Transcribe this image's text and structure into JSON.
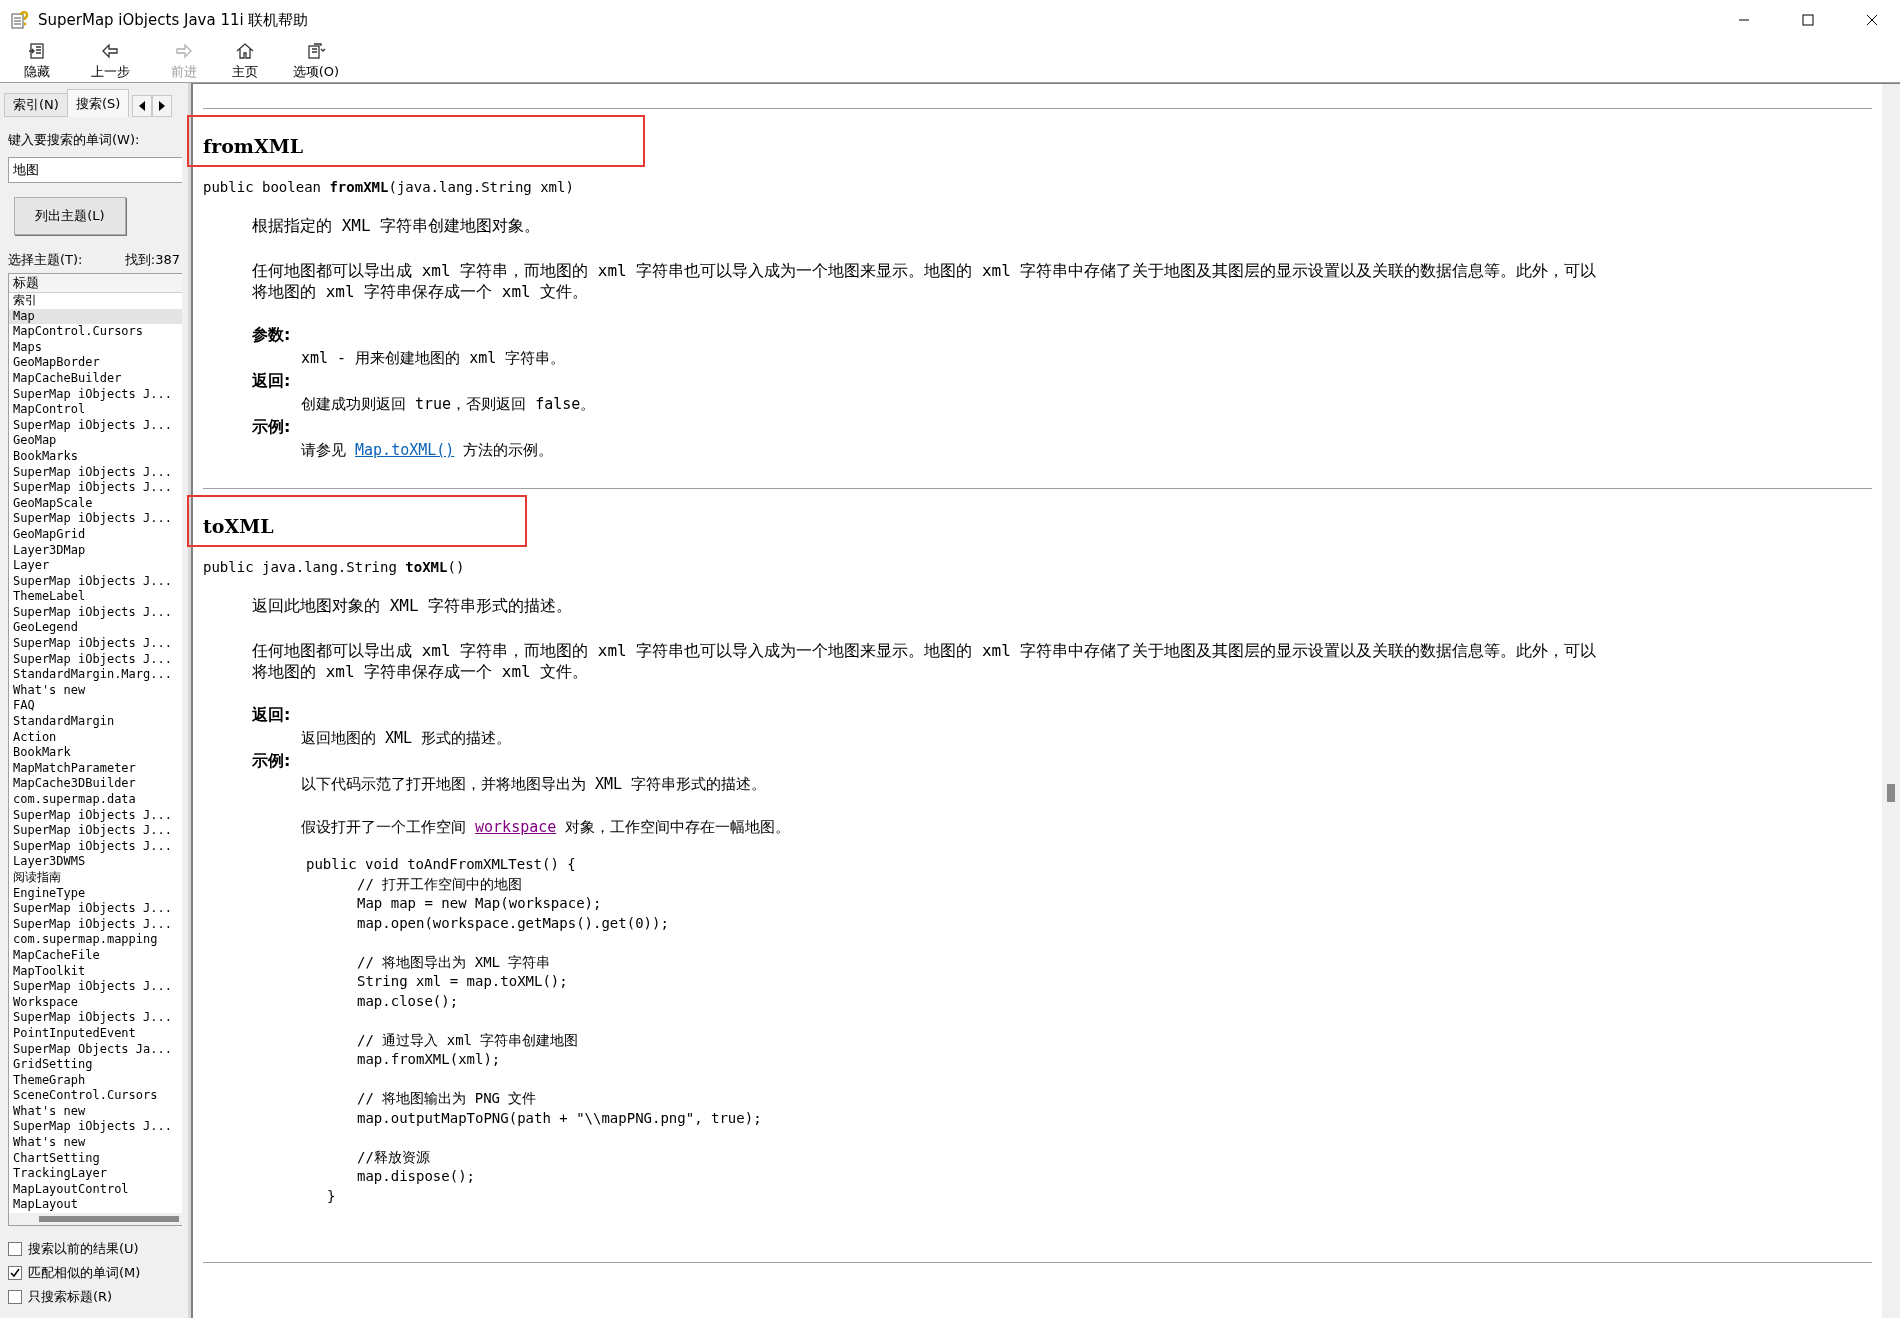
{
  "window": {
    "title": "SuperMap iObjects Java 11i 联机帮助"
  },
  "toolbar": [
    {
      "label": "隐藏",
      "disabled": false
    },
    {
      "label": "上一步",
      "disabled": false
    },
    {
      "label": "前进",
      "disabled": true
    },
    {
      "label": "主页",
      "disabled": false
    },
    {
      "label": "选项(O)",
      "disabled": false
    }
  ],
  "sidebar": {
    "tabs": [
      {
        "label": "索引(N)",
        "selected": false
      },
      {
        "label": "搜索(S)",
        "selected": true
      }
    ],
    "search_label": "键入要搜索的单词(W):",
    "search_value": "地图",
    "list_button": "列出主题(L)",
    "topics_label": "选择主题(T):",
    "found": "找到:387",
    "column": "标题",
    "topics": [
      {
        "label": "索引",
        "selected": false
      },
      {
        "label": "Map",
        "selected": true
      },
      {
        "label": "MapControl.Cursors",
        "selected": false
      },
      {
        "label": "Maps",
        "selected": false
      },
      {
        "label": "GeoMapBorder",
        "selected": false
      },
      {
        "label": "MapCacheBuilder",
        "selected": false
      },
      {
        "label": "SuperMap iObjects J...",
        "selected": false
      },
      {
        "label": "MapControl",
        "selected": false
      },
      {
        "label": "SuperMap iObjects J...",
        "selected": false
      },
      {
        "label": "GeoMap",
        "selected": false
      },
      {
        "label": "BookMarks",
        "selected": false
      },
      {
        "label": "SuperMap iObjects J...",
        "selected": false
      },
      {
        "label": "SuperMap iObjects J...",
        "selected": false
      },
      {
        "label": "GeoMapScale",
        "selected": false
      },
      {
        "label": "SuperMap iObjects J...",
        "selected": false
      },
      {
        "label": "GeoMapGrid",
        "selected": false
      },
      {
        "label": "Layer3DMap",
        "selected": false
      },
      {
        "label": "Layer",
        "selected": false
      },
      {
        "label": "SuperMap iObjects J...",
        "selected": false
      },
      {
        "label": "ThemeLabel",
        "selected": false
      },
      {
        "label": "SuperMap iObjects J...",
        "selected": false
      },
      {
        "label": "GeoLegend",
        "selected": false
      },
      {
        "label": "SuperMap iObjects J...",
        "selected": false
      },
      {
        "label": "SuperMap iObjects J...",
        "selected": false
      },
      {
        "label": "StandardMargin.Marg...",
        "selected": false
      },
      {
        "label": "What's new",
        "selected": false
      },
      {
        "label": "FAQ",
        "selected": false
      },
      {
        "label": "StandardMargin",
        "selected": false
      },
      {
        "label": "Action",
        "selected": false
      },
      {
        "label": "BookMark",
        "selected": false
      },
      {
        "label": "MapMatchParameter",
        "selected": false
      },
      {
        "label": "MapCache3DBuilder",
        "selected": false
      },
      {
        "label": "com.supermap.data",
        "selected": false
      },
      {
        "label": "SuperMap iObjects J...",
        "selected": false
      },
      {
        "label": "SuperMap iObjects J...",
        "selected": false
      },
      {
        "label": "SuperMap iObjects J...",
        "selected": false
      },
      {
        "label": "Layer3DWMS",
        "selected": false
      },
      {
        "label": "阅读指南",
        "selected": false
      },
      {
        "label": "EngineType",
        "selected": false
      },
      {
        "label": "SuperMap iObjects J...",
        "selected": false
      },
      {
        "label": "SuperMap iObjects J...",
        "selected": false
      },
      {
        "label": "com.supermap.mapping",
        "selected": false
      },
      {
        "label": "MapCacheFile",
        "selected": false
      },
      {
        "label": "MapToolkit",
        "selected": false
      },
      {
        "label": "SuperMap iObjects J...",
        "selected": false
      },
      {
        "label": "Workspace",
        "selected": false
      },
      {
        "label": "SuperMap iObjects J...",
        "selected": false
      },
      {
        "label": "PointInputedEvent",
        "selected": false
      },
      {
        "label": "SuperMap Objects Ja...",
        "selected": false
      },
      {
        "label": "GridSetting",
        "selected": false
      },
      {
        "label": "ThemeGraph",
        "selected": false
      },
      {
        "label": "SceneControl.Cursors",
        "selected": false
      },
      {
        "label": "What's new",
        "selected": false
      },
      {
        "label": "SuperMap iObjects J...",
        "selected": false
      },
      {
        "label": "What's new",
        "selected": false
      },
      {
        "label": "ChartSetting",
        "selected": false
      },
      {
        "label": "TrackingLayer",
        "selected": false
      },
      {
        "label": "MapLayoutControl",
        "selected": false
      },
      {
        "label": "MapLayout",
        "selected": false
      }
    ],
    "options": [
      {
        "label": "搜索以前的结果(U)",
        "checked": false
      },
      {
        "label": "匹配相似的单词(M)",
        "checked": true
      },
      {
        "label": "只搜索标题(R)",
        "checked": false
      }
    ]
  },
  "content": {
    "sections": [
      {
        "heading": "fromXML",
        "signature": {
          "prefix": "public boolean ",
          "name": "fromXML",
          "suffix": "(java.lang.String xml)"
        },
        "description": "根据指定的 XML 字符串创建地图对象。",
        "paragraph": [
          "任何地图都可以导出成 xml 字符串，而地图的 xml 字符串也可以导入成为一个地图来显示。地图的 xml 字符串中存储了关于地图及其图层的显示设置以及关联的数据信息等。此外，可以",
          "将地图的 xml 字符串保存成一个 xml 文件。"
        ],
        "details": [
          {
            "label": "参数:",
            "lines": [
              {
                "text": "xml - 用来创建地图的 xml 字符串。"
              }
            ]
          },
          {
            "label": "返回:",
            "lines": [
              {
                "text": "创建成功则返回 true，否则返回 false。"
              }
            ]
          },
          {
            "label": "示例:",
            "lines": [
              {
                "text": "请参见 ",
                "link": "Map.toXML()",
                "after": " 方法的示例。",
                "visited": false
              }
            ]
          }
        ]
      },
      {
        "heading": "toXML",
        "signature": {
          "prefix": "public java.lang.String ",
          "name": "toXML",
          "suffix": "()"
        },
        "description": "返回此地图对象的 XML 字符串形式的描述。",
        "paragraph": [
          "任何地图都可以导出成 xml 字符串，而地图的 xml 字符串也可以导入成为一个地图来显示。地图的 xml 字符串中存储了关于地图及其图层的显示设置以及关联的数据信息等。此外，可以",
          "将地图的 xml 字符串保存成一个 xml 文件。"
        ],
        "details": [
          {
            "label": "返回:",
            "lines": [
              {
                "text": "返回地图的 XML 形式的描述。"
              }
            ]
          },
          {
            "label": "示例:",
            "lines": [
              {
                "text": "以下代码示范了打开地图，并将地图导出为 XML 字符串形式的描述。"
              },
              {
                "text": "假设打开了一个工作空间 ",
                "link": "workspace",
                "after": " 对象，工作空间中存在一幅地图。",
                "visited": true
              }
            ],
            "code": {
              "opening": "public void toAndFromXMLTest() {",
              "groups": [
                [
                  "// 打开工作空间中的地图",
                  "Map map = new Map(workspace);",
                  "map.open(workspace.getMaps().get(0));"
                ],
                [
                  "// 将地图导出为 XML 字符串",
                  "String xml = map.toXML();",
                  "map.close();"
                ],
                [
                  "// 通过导入 xml 字符串创建地图",
                  "map.fromXML(xml);"
                ],
                [
                  "// 将地图输出为 PNG 文件",
                  "map.outputMapToPNG(path + \"\\\\mapPNG.png\", true);"
                ],
                [
                  "//释放资源",
                  "map.dispose();"
                ]
              ],
              "closing": "}"
            }
          }
        ]
      }
    ]
  }
}
